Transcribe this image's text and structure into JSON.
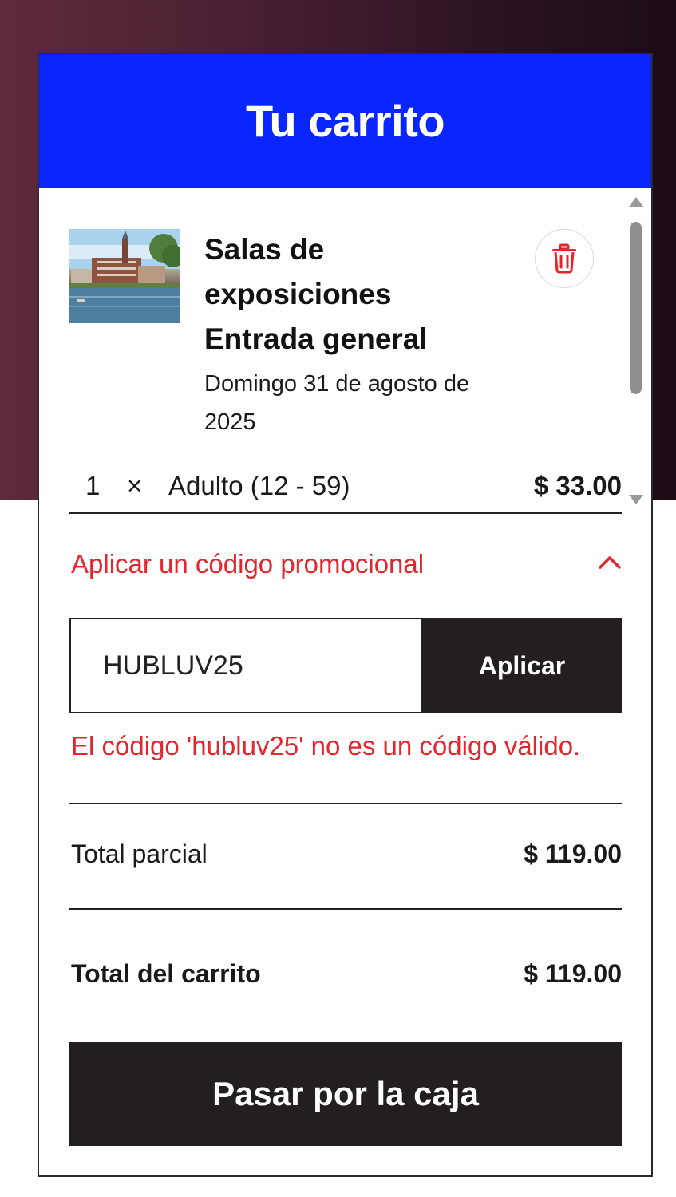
{
  "cart": {
    "title": "Tu carrito",
    "items": [
      {
        "name": "Salas de exposiciones Entrada general",
        "date": "Domingo 31 de agosto de 2025",
        "image": "campus-lake-photo",
        "lines": [
          {
            "qty": "1",
            "times": "×",
            "description": "Adulto (12 - 59)",
            "price": "$ 33.00"
          }
        ]
      }
    ],
    "icons": {
      "remove": "trash-icon",
      "promo_toggle": "chevron-up-icon"
    }
  },
  "promo": {
    "toggle_label": "Aplicar un código promocional",
    "input_value": "HUBLUV25",
    "apply_label": "Aplicar",
    "error_message": "El código 'hubluv25' no es un código válido."
  },
  "summary": {
    "subtotal_label": "Total parcial",
    "subtotal_value": "$ 119.00",
    "total_label": "Total del carrito",
    "total_value": "$ 119.00"
  },
  "checkout": {
    "label": "Pasar por la caja"
  },
  "colors": {
    "header_bg": "#0a26ff",
    "accent_red": "#e3262d",
    "button_dark": "#231f20"
  }
}
